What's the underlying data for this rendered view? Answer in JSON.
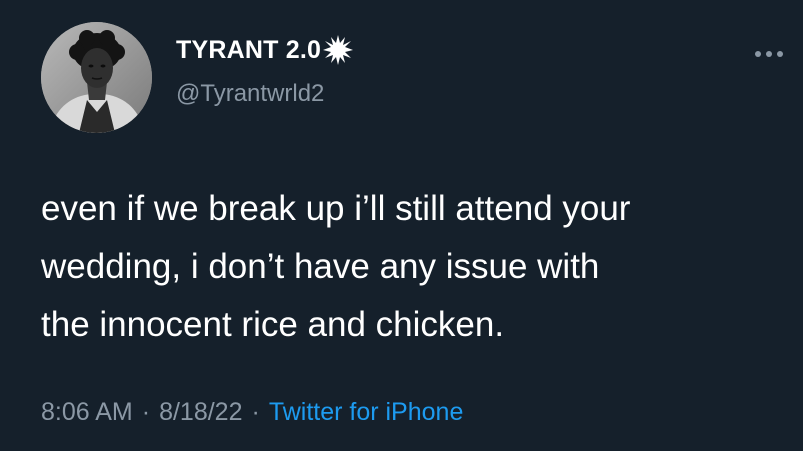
{
  "user": {
    "display_name": "TYRANT 2.0",
    "handle": "@Tyrantwrld2",
    "name_badge_icon": "starburst-icon",
    "avatar_icon": "profile-photo"
  },
  "actions": {
    "more_icon": "more-horizontal-icon"
  },
  "tweet": {
    "text": "even if we break up i’ll still attend your\nwedding, i don’t have any issue with\nthe innocent rice and chicken.",
    "time": "8:06 AM",
    "date": "8/18/22",
    "separator": "·",
    "source": "Twitter for iPhone"
  },
  "colors": {
    "background": "#15202b",
    "primary_text": "#ffffff",
    "secondary_text": "#8b98a5",
    "link": "#1d9bf0"
  }
}
